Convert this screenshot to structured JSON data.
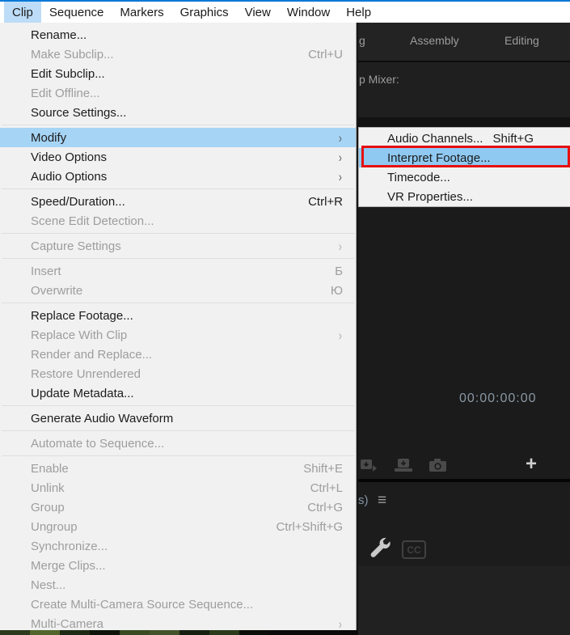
{
  "menubar": {
    "items": [
      {
        "label": "Clip",
        "selected": true
      },
      {
        "label": "Sequence"
      },
      {
        "label": "Markers"
      },
      {
        "label": "Graphics"
      },
      {
        "label": "View"
      },
      {
        "label": "Window"
      },
      {
        "label": "Help"
      }
    ]
  },
  "clip_menu": {
    "items": [
      {
        "label": "Rename...",
        "enabled": true
      },
      {
        "label": "Make Subclip...",
        "shortcut": "Ctrl+U",
        "enabled": false
      },
      {
        "label": "Edit Subclip...",
        "enabled": true
      },
      {
        "label": "Edit Offline...",
        "enabled": false
      },
      {
        "label": "Source Settings...",
        "enabled": true
      },
      {
        "type": "separator"
      },
      {
        "label": "Modify",
        "enabled": true,
        "submenu": true,
        "highlighted": true
      },
      {
        "label": "Video Options",
        "enabled": true,
        "submenu": true
      },
      {
        "label": "Audio Options",
        "enabled": true,
        "submenu": true
      },
      {
        "type": "separator"
      },
      {
        "label": "Speed/Duration...",
        "shortcut": "Ctrl+R",
        "enabled": true
      },
      {
        "label": "Scene Edit Detection...",
        "enabled": false
      },
      {
        "type": "separator"
      },
      {
        "label": "Capture Settings",
        "enabled": false,
        "submenu": true
      },
      {
        "type": "separator"
      },
      {
        "label": "Insert",
        "shortcut": "Б",
        "enabled": false
      },
      {
        "label": "Overwrite",
        "shortcut": "Ю",
        "enabled": false
      },
      {
        "type": "separator"
      },
      {
        "label": "Replace Footage...",
        "enabled": true
      },
      {
        "label": "Replace With Clip",
        "enabled": false,
        "submenu": true
      },
      {
        "label": "Render and Replace...",
        "enabled": false
      },
      {
        "label": "Restore Unrendered",
        "enabled": false
      },
      {
        "label": "Update Metadata...",
        "enabled": true
      },
      {
        "type": "separator"
      },
      {
        "label": "Generate Audio Waveform",
        "enabled": true
      },
      {
        "type": "separator"
      },
      {
        "label": "Automate to Sequence...",
        "enabled": false
      },
      {
        "type": "separator"
      },
      {
        "label": "Enable",
        "shortcut": "Shift+E",
        "enabled": false
      },
      {
        "label": "Unlink",
        "shortcut": "Ctrl+L",
        "enabled": false
      },
      {
        "label": "Group",
        "shortcut": "Ctrl+G",
        "enabled": false
      },
      {
        "label": "Ungroup",
        "shortcut": "Ctrl+Shift+G",
        "enabled": false
      },
      {
        "label": "Synchronize...",
        "enabled": false
      },
      {
        "label": "Merge Clips...",
        "enabled": false
      },
      {
        "label": "Nest...",
        "enabled": false
      },
      {
        "label": "Create Multi-Camera Source Sequence...",
        "enabled": false
      },
      {
        "label": "Multi-Camera",
        "enabled": false,
        "submenu": true
      }
    ]
  },
  "modify_submenu": {
    "items": [
      {
        "label": "Audio Channels...",
        "shortcut": "Shift+G",
        "enabled": true
      },
      {
        "label": "Interpret Footage...",
        "enabled": true,
        "highlighted": true,
        "annotated": true
      },
      {
        "label": "Timecode...",
        "enabled": true
      },
      {
        "label": "VR Properties...",
        "enabled": true
      }
    ]
  },
  "workspace_bar": {
    "tab_fragment": "g",
    "tabs": [
      "Assembly",
      "Editing"
    ]
  },
  "source_panel": {
    "header_fragment": "p Mixer:",
    "timecode": "00:00:00:00"
  },
  "timeline_panel": {
    "title_fragment": "s)"
  },
  "icons": {
    "panel_menu_glyph": "≡",
    "button_editor_glyph": "+",
    "closed_captions_glyph": "CC"
  },
  "colors": {
    "window_accent_top": "#0078d7",
    "menu_highlight_blue": "#a6d4f5",
    "submenu_highlight_blue": "#8fc9f2",
    "annotation_red": "#e60f0f",
    "timecode_text": "#8a97a3"
  },
  "bin_strip_colors": [
    "#2e3a1e",
    "#52652c",
    "#1f2b15",
    "#0e130a",
    "#3a4a22",
    "#44522a",
    "#161f10",
    "#2c3a1c",
    "#0b0e08"
  ]
}
